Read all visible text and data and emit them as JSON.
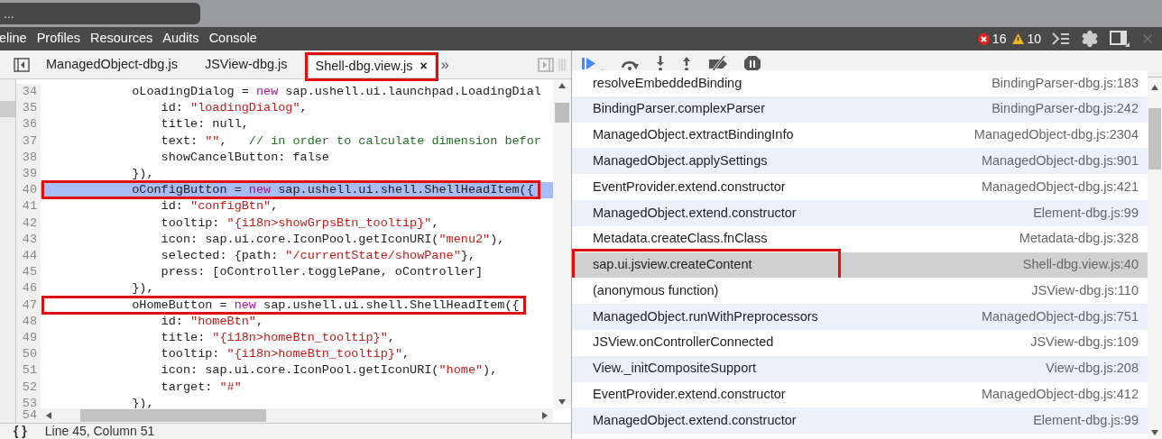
{
  "address_bar": {
    "value": "..."
  },
  "menu": [
    {
      "label": "eline"
    },
    {
      "label": "Profiles"
    },
    {
      "label": "Resources"
    },
    {
      "label": "Audits"
    },
    {
      "label": "Console"
    }
  ],
  "status": {
    "errors": "16",
    "warnings": "10"
  },
  "file_tabs": [
    {
      "label": "ManagedObject-dbg.js",
      "selected": false,
      "annotated": false
    },
    {
      "label": "JSView-dbg.js",
      "selected": false,
      "annotated": false
    },
    {
      "label": "Shell-dbg.view.js",
      "selected": true,
      "annotated": true,
      "close": "×"
    }
  ],
  "more_tabs": "»",
  "code_lines": [
    {
      "number": "34",
      "highlighted": false,
      "annotated": false,
      "segments": [
        {
          "kind": "plain",
          "text": "            oLoadingDialog = "
        },
        {
          "kind": "keyword",
          "text": "new"
        },
        {
          "kind": "plain",
          "text": " sap.ushell.ui.launchpad.LoadingDial"
        }
      ]
    },
    {
      "number": "35",
      "highlighted": false,
      "annotated": false,
      "segments": [
        {
          "kind": "plain",
          "text": "                id: "
        },
        {
          "kind": "string",
          "text": "\"loadingDialog\""
        },
        {
          "kind": "plain",
          "text": ","
        }
      ]
    },
    {
      "number": "36",
      "highlighted": false,
      "annotated": false,
      "segments": [
        {
          "kind": "plain",
          "text": "                title: null,"
        }
      ]
    },
    {
      "number": "37",
      "highlighted": false,
      "annotated": false,
      "segments": [
        {
          "kind": "plain",
          "text": "                text: "
        },
        {
          "kind": "string",
          "text": "\"\""
        },
        {
          "kind": "plain",
          "text": ",   "
        },
        {
          "kind": "comment",
          "text": "// in order to calculate dimension befor"
        }
      ]
    },
    {
      "number": "38",
      "highlighted": false,
      "annotated": false,
      "segments": [
        {
          "kind": "plain",
          "text": "                showCancelButton: false"
        }
      ]
    },
    {
      "number": "39",
      "highlighted": false,
      "annotated": false,
      "segments": [
        {
          "kind": "plain",
          "text": "            }),"
        }
      ]
    },
    {
      "number": "40",
      "highlighted": true,
      "annotated": true,
      "segments": [
        {
          "kind": "plain",
          "text": "            oConfigButton = "
        },
        {
          "kind": "keyword",
          "text": "new"
        },
        {
          "kind": "plain",
          "text": " sap.ushell.ui.shell.ShellHeadItem({"
        }
      ]
    },
    {
      "number": "41",
      "highlighted": false,
      "annotated": false,
      "segments": [
        {
          "kind": "plain",
          "text": "                id: "
        },
        {
          "kind": "string",
          "text": "\"configBtn\""
        },
        {
          "kind": "plain",
          "text": ","
        }
      ]
    },
    {
      "number": "42",
      "highlighted": false,
      "annotated": false,
      "segments": [
        {
          "kind": "plain",
          "text": "                tooltip: "
        },
        {
          "kind": "string",
          "text": "\"{i18n>showGrpsBtn_tooltip}\""
        },
        {
          "kind": "plain",
          "text": ","
        }
      ]
    },
    {
      "number": "43",
      "highlighted": false,
      "annotated": false,
      "segments": [
        {
          "kind": "plain",
          "text": "                icon: sap.ui.core.IconPool.getIconURI("
        },
        {
          "kind": "string",
          "text": "\"menu2\""
        },
        {
          "kind": "plain",
          "text": "),"
        }
      ]
    },
    {
      "number": "44",
      "highlighted": false,
      "annotated": false,
      "segments": [
        {
          "kind": "plain",
          "text": "                selected: {path: "
        },
        {
          "kind": "string",
          "text": "\"/currentState/showPane\""
        },
        {
          "kind": "plain",
          "text": "},"
        }
      ]
    },
    {
      "number": "45",
      "highlighted": false,
      "annotated": false,
      "segments": [
        {
          "kind": "plain",
          "text": "                press: [oController.togglePane, oController]"
        }
      ]
    },
    {
      "number": "46",
      "highlighted": false,
      "annotated": false,
      "segments": [
        {
          "kind": "plain",
          "text": "            }),"
        }
      ]
    },
    {
      "number": "47",
      "highlighted": false,
      "annotated": true,
      "segments": [
        {
          "kind": "plain",
          "text": "            oHomeButton = "
        },
        {
          "kind": "keyword",
          "text": "new"
        },
        {
          "kind": "plain",
          "text": " sap.ushell.ui.shell.ShellHeadItem({"
        }
      ]
    },
    {
      "number": "48",
      "highlighted": false,
      "annotated": false,
      "segments": [
        {
          "kind": "plain",
          "text": "                id: "
        },
        {
          "kind": "string",
          "text": "\"homeBtn\""
        },
        {
          "kind": "plain",
          "text": ","
        }
      ]
    },
    {
      "number": "49",
      "highlighted": false,
      "annotated": false,
      "segments": [
        {
          "kind": "plain",
          "text": "                title: "
        },
        {
          "kind": "string",
          "text": "\"{i18n>homeBtn_tooltip}\""
        },
        {
          "kind": "plain",
          "text": ","
        }
      ]
    },
    {
      "number": "50",
      "highlighted": false,
      "annotated": false,
      "segments": [
        {
          "kind": "plain",
          "text": "                tooltip: "
        },
        {
          "kind": "string",
          "text": "\"{i18n>homeBtn_tooltip}\""
        },
        {
          "kind": "plain",
          "text": ","
        }
      ]
    },
    {
      "number": "51",
      "highlighted": false,
      "annotated": false,
      "segments": [
        {
          "kind": "plain",
          "text": "                icon: sap.ui.core.IconPool.getIconURI("
        },
        {
          "kind": "string",
          "text": "\"home\""
        },
        {
          "kind": "plain",
          "text": "),"
        }
      ]
    },
    {
      "number": "52",
      "highlighted": false,
      "annotated": false,
      "segments": [
        {
          "kind": "plain",
          "text": "                target: "
        },
        {
          "kind": "string",
          "text": "\"#\""
        }
      ]
    },
    {
      "number": "53",
      "highlighted": false,
      "annotated": false,
      "segments": [
        {
          "kind": "plain",
          "text": "            }),"
        }
      ]
    }
  ],
  "last_line_number": "54",
  "status_bar": {
    "format": "{ }",
    "position": "Line 45, Column 51"
  },
  "call_stack": [
    {
      "function": "resolveEmbeddedBinding",
      "location": "BindingParser-dbg.js:183",
      "selected": false,
      "annotated": false
    },
    {
      "function": "BindingParser.complexParser",
      "location": "BindingParser-dbg.js:242",
      "selected": false,
      "annotated": false
    },
    {
      "function": "ManagedObject.extractBindingInfo",
      "location": "ManagedObject-dbg.js:2304",
      "selected": false,
      "annotated": false
    },
    {
      "function": "ManagedObject.applySettings",
      "location": "ManagedObject-dbg.js:901",
      "selected": false,
      "annotated": false
    },
    {
      "function": "EventProvider.extend.constructor",
      "location": "ManagedObject-dbg.js:421",
      "selected": false,
      "annotated": false
    },
    {
      "function": "ManagedObject.extend.constructor",
      "location": "Element-dbg.js:99",
      "selected": false,
      "annotated": false
    },
    {
      "function": "Metadata.createClass.fnClass",
      "location": "Metadata-dbg.js:328",
      "selected": false,
      "annotated": false
    },
    {
      "function": "sap.ui.jsview.createContent",
      "location": "Shell-dbg.view.js:40",
      "selected": true,
      "annotated": true
    },
    {
      "function": "(anonymous function)",
      "location": "JSView-dbg.js:110",
      "selected": false,
      "annotated": false
    },
    {
      "function": "ManagedObject.runWithPreprocessors",
      "location": "ManagedObject-dbg.js:751",
      "selected": false,
      "annotated": false
    },
    {
      "function": "JSView.onControllerConnected",
      "location": "JSView-dbg.js:109",
      "selected": false,
      "annotated": false
    },
    {
      "function": "View._initCompositeSupport",
      "location": "View-dbg.js:208",
      "selected": false,
      "annotated": false
    },
    {
      "function": "EventProvider.extend.constructor",
      "location": "ManagedObject-dbg.js:412",
      "selected": false,
      "annotated": false
    },
    {
      "function": "ManagedObject.extend.constructor",
      "location": "Element-dbg.js:99",
      "selected": false,
      "annotated": false
    }
  ]
}
